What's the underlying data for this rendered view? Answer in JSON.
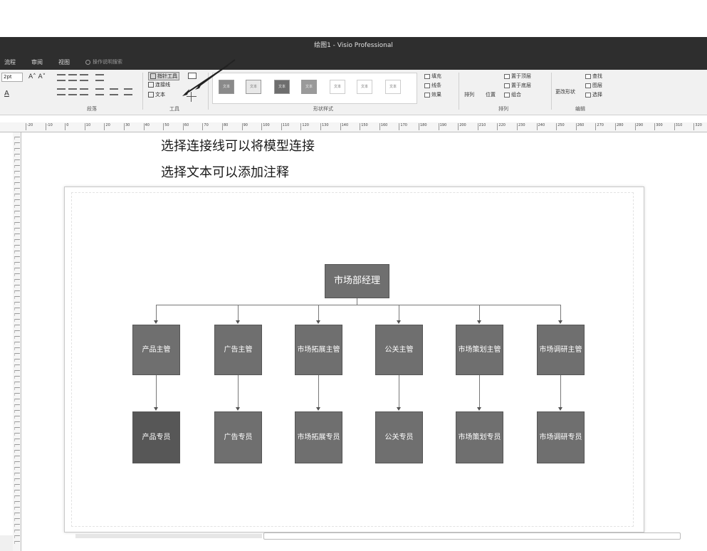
{
  "window": {
    "title": "绘图1 - Visio Professional"
  },
  "ribbon_tabs": [
    "流程",
    "审阅",
    "视图"
  ],
  "tell_me": {
    "placeholder": "操作说明搜索"
  },
  "font": {
    "size_value": "2pt",
    "grow_label": "A˄ A˅",
    "font_color_glyph": "A"
  },
  "groups": {
    "paragraph": "段落",
    "tools": "工具",
    "shape_styles": "形状样式",
    "arrange": "排列",
    "editing": "编辑"
  },
  "tools": {
    "pointer": "指针工具",
    "connector": "连接线",
    "text": "文本"
  },
  "shape_style_thumbs": [
    "文本",
    "文本",
    "文本",
    "文本",
    "文本",
    "文本",
    "文本"
  ],
  "shape_format": {
    "fill": "填充",
    "line": "线条",
    "effects": "效果"
  },
  "arrange": {
    "align": "排列",
    "position": "位置",
    "bring_front": "置于顶层",
    "send_back": "置于底层",
    "group": "组合"
  },
  "editing": {
    "change_shape": "更改形状",
    "find": "查找",
    "layers": "图层",
    "select": "选择"
  },
  "ruler_ticks": [
    "-20",
    "-10",
    "0",
    "10",
    "20",
    "30",
    "40",
    "50",
    "60",
    "70",
    "80",
    "90",
    "100",
    "110",
    "120",
    "130",
    "140",
    "150",
    "160",
    "170",
    "180",
    "190",
    "200",
    "210",
    "220",
    "230",
    "240",
    "250",
    "260",
    "270",
    "280",
    "290",
    "300",
    "310",
    "320"
  ],
  "annotations": [
    "选择连接线可以将模型连接",
    "选择文本可以添加注释"
  ],
  "org_chart": {
    "manager": "市场部经理",
    "supervisors": [
      [
        "产品主管"
      ],
      [
        "广告主管"
      ],
      [
        "市场拓展",
        "主管"
      ],
      [
        "公关主管"
      ],
      [
        "市场策划",
        "主管"
      ],
      [
        "市场调研",
        "主管"
      ]
    ],
    "specialists": [
      [
        "产品专员"
      ],
      [
        "广告专员"
      ],
      [
        "市场拓展",
        "专员"
      ],
      [
        "公关专员"
      ],
      [
        "市场策划",
        "专员"
      ],
      [
        "市场调研",
        "专员"
      ]
    ]
  },
  "colors": {
    "node_fill": "#6f6f6f",
    "node_fill_dark": "#575757",
    "titlebar": "#2e2e2e",
    "ribbon": "#f1f1f1"
  }
}
